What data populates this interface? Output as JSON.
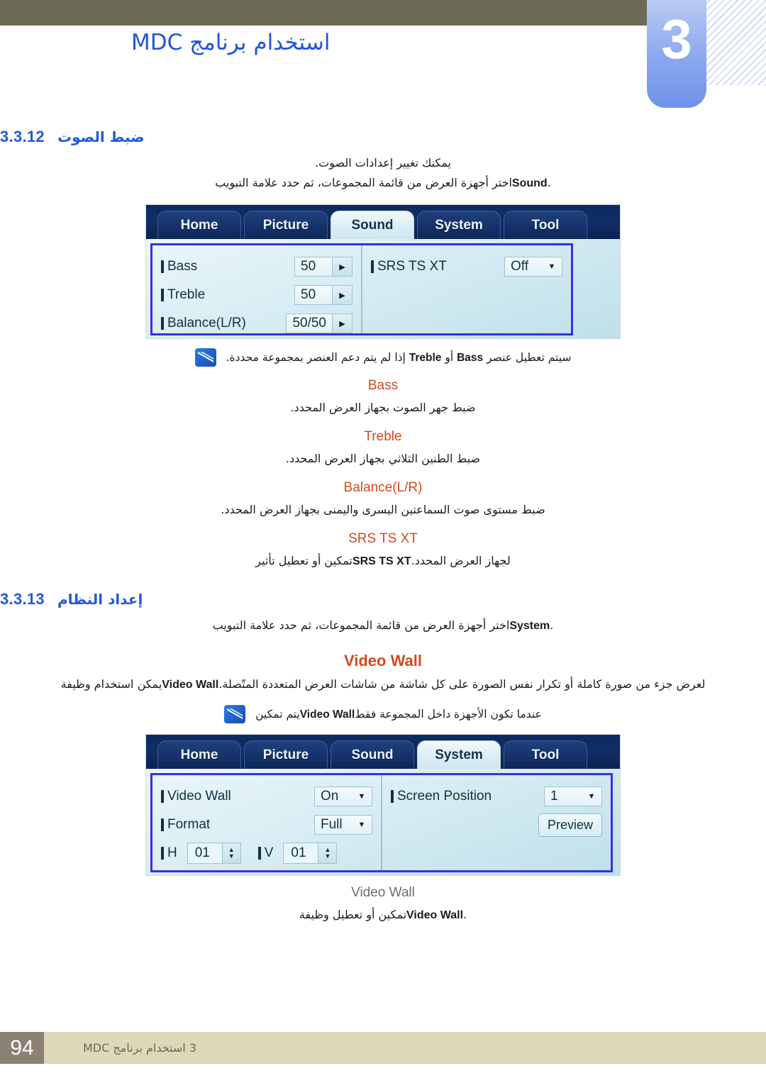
{
  "header": {
    "chapter_number": "3",
    "title": "استخدام برنامج MDC",
    "hatch_icon": "diagonal-hatch-pattern"
  },
  "colors": {
    "olive_bar": "#6d6b57",
    "chapter_tab_blue": "#8aa8ee",
    "heading_blue": "#2459d6",
    "label_orange": "#d4491c",
    "label_gray": "#6a6f72",
    "frame_purple": "#3b2fe0",
    "footer_beige": "#ded7b8",
    "page_box_brown": "#8c8172"
  },
  "sections": [
    {
      "number": "3.3.12",
      "name": "ضبط الصوت",
      "intro_1": "يمكنك تغيير إعدادات الصوت.",
      "intro_2_pre": "اختر أجهزة العرض من قائمة المجموعات، ثم حدد علامة التبويب ",
      "intro_2_bold": "Sound",
      "intro_2_post": "."
    },
    {
      "number": "3.3.13",
      "name": "إعداد النظام",
      "intro_2_pre": "اختر أجهزة العرض من قائمة المجموعات، ثم حدد علامة التبويب ",
      "intro_2_bold": "System",
      "intro_2_post": "."
    }
  ],
  "sound_screenshot": {
    "tabs": [
      {
        "label": "Home",
        "active": false
      },
      {
        "label": "Picture",
        "active": false
      },
      {
        "label": "Sound",
        "active": true
      },
      {
        "label": "System",
        "active": false
      },
      {
        "label": "Tool",
        "active": false
      }
    ],
    "left_rows": [
      {
        "label": "Bass",
        "value": "50"
      },
      {
        "label": "Treble",
        "value": "50"
      },
      {
        "label": "Balance(L/R)",
        "value": "50/50"
      }
    ],
    "right_rows": [
      {
        "label": "SRS TS XT",
        "value": "Off"
      }
    ]
  },
  "sound_notes": {
    "note_pre": "سيتم تعطيل عنصر ",
    "note_b1": "Bass",
    "note_mid1": " أو ",
    "note_b2": "Treble",
    "note_post": " إذا لم يتم دعم العنصر بمجموعة محددة.",
    "items": [
      {
        "label": "Bass",
        "desc": "ضبط جهر الصوت بجهاز العرض المحدد."
      },
      {
        "label": "Treble",
        "desc": "ضبط الطنين الثلاثي بجهاز العرض المحدد."
      },
      {
        "label": "Balance(L/R)",
        "desc": "ضبط مستوى صوت السماعتين اليسرى واليمنى بجهاز العرض المحدد."
      }
    ],
    "srs": {
      "label": "SRS TS XT",
      "desc_pre": "تمكين أو تعطيل تأثير ",
      "desc_bold": "SRS TS XT",
      "desc_post": " لجهاز العرض المحدد."
    }
  },
  "videowall": {
    "heading": "Video Wall",
    "desc_pre": "يمكن استخدام وظيفة ",
    "desc_bold": "Video Wall",
    "desc_post": " لعرض جزء من صورة كاملة أو تكرار نفس الصورة على كل شاشة من شاشات العرض المتعددة المتّصلة.",
    "note_pre": "يتم تمكين ",
    "note_bold": "Video Wall",
    "note_post": " عندما تكون الأجهزة داخل المجموعة فقط",
    "sub_label": "Video Wall",
    "sub_desc_pre": "تمكين أو تعطيل وظيفة ",
    "sub_desc_bold": "Video Wall",
    "sub_desc_post": "."
  },
  "system_screenshot": {
    "tabs": [
      {
        "label": "Home",
        "active": false
      },
      {
        "label": "Picture",
        "active": false
      },
      {
        "label": "Sound",
        "active": false
      },
      {
        "label": "System",
        "active": true
      },
      {
        "label": "Tool",
        "active": false
      }
    ],
    "left_rows": [
      {
        "label": "Video Wall",
        "value": "On"
      },
      {
        "label": "Format",
        "value": "Full"
      }
    ],
    "spinners": [
      {
        "label": "H",
        "value": "01"
      },
      {
        "label": "V",
        "value": "01"
      }
    ],
    "right_row": {
      "label": "Screen Position",
      "value": "1"
    },
    "preview_button": "Preview"
  },
  "footer": {
    "page_number": "94",
    "text": "3 استخدام برنامج MDC"
  }
}
